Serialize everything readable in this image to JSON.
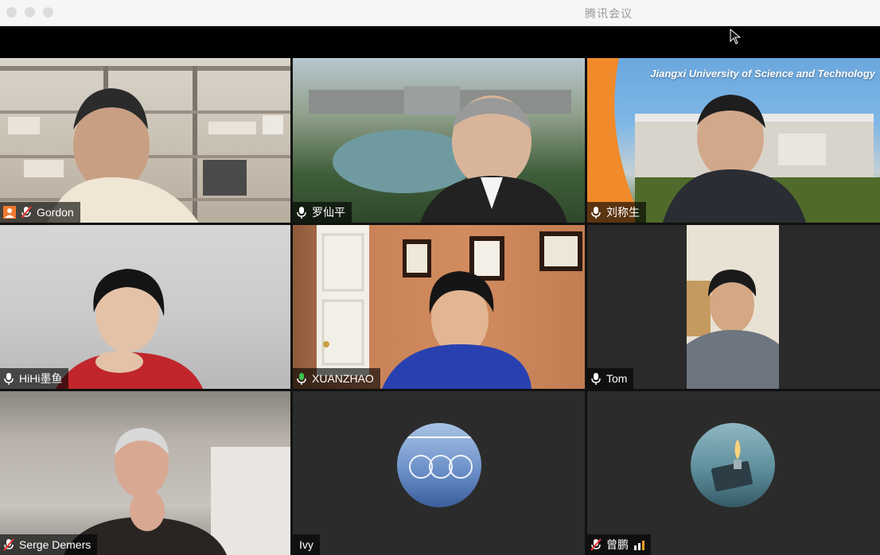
{
  "window": {
    "title": "腾讯会议"
  },
  "participants": [
    {
      "name": "Gordon",
      "mic": "muted"
    },
    {
      "name": "罗仙平",
      "mic": "on"
    },
    {
      "name": "刘称生",
      "mic": "on",
      "banner": "Jiangxi University of Science and Technology"
    },
    {
      "name": "HiHi墨鱼",
      "mic": "on"
    },
    {
      "name": "XUANZHAO",
      "mic": "speaking"
    },
    {
      "name": "Tom",
      "mic": "on"
    },
    {
      "name": "Serge Demers",
      "mic": "muted"
    },
    {
      "name": "Ivy",
      "mic": "none"
    },
    {
      "name": "曾鹏",
      "mic": "muted"
    }
  ],
  "colors": {
    "speaking": "#3ea84a",
    "label_bg": "rgba(0,0,0,0.62)",
    "titlebar": "#f6f6f6"
  }
}
